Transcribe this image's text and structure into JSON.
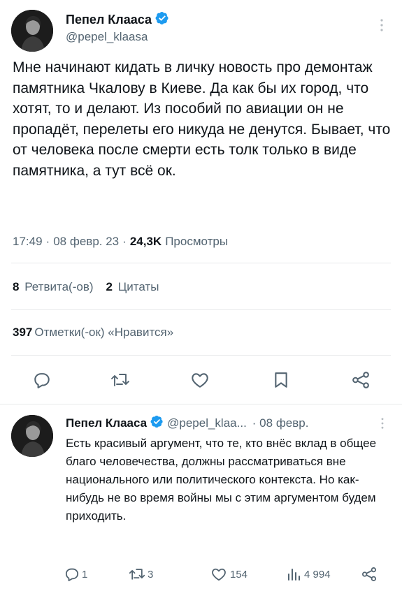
{
  "tweet": {
    "author_name": "Пепел Клааса",
    "author_handle": "@pepel_klaasa",
    "text": "Мне начинают кидать в личку новость про демонтаж памятника Чкалову в Киеве. Да как бы их город, что хотят, то и делают. Из пособий по авиации он не пропадёт, перелеты его никуда не денутся. Бывает, что от человека после смерти есть толк только в виде памятника, а тут всё ок.",
    "time": "17:49",
    "date": "08 февр. 23",
    "views_count": "24,3K",
    "views_label": "Просмотры",
    "sep": "·"
  },
  "stats": {
    "retweets_count": "8",
    "retweets_label": "Ретвита(-ов)",
    "quotes_count": "2",
    "quotes_label": "Цитаты",
    "likes_count": "397",
    "likes_label": "Отметки(-ок) «Нравится»"
  },
  "icons": {
    "reply": "reply-icon",
    "retweet": "retweet-icon",
    "like": "heart-icon",
    "bookmark": "bookmark-icon",
    "share": "share-icon",
    "more": "more-vertical-icon",
    "verified": "verified-badge-icon",
    "views": "views-icon"
  },
  "reply": {
    "author_name": "Пепел Клааса",
    "author_handle": "@pepel_klaa...",
    "date": "· 08 февр.",
    "text": "Есть красивый аргумент, что те, кто внёс вклад в общее благо человечества, должны рассматриваться вне национального или политического контекста. Но как-нибудь не во время войны мы с этим аргументом будем приходить.",
    "reply_count": "1",
    "retweet_count": "3",
    "like_count": "154",
    "views_count": "4 994"
  },
  "colors": {
    "verified": "#1d9bf0",
    "text": "#0f1419",
    "muted": "#536471",
    "divider": "#e7e9ea"
  }
}
